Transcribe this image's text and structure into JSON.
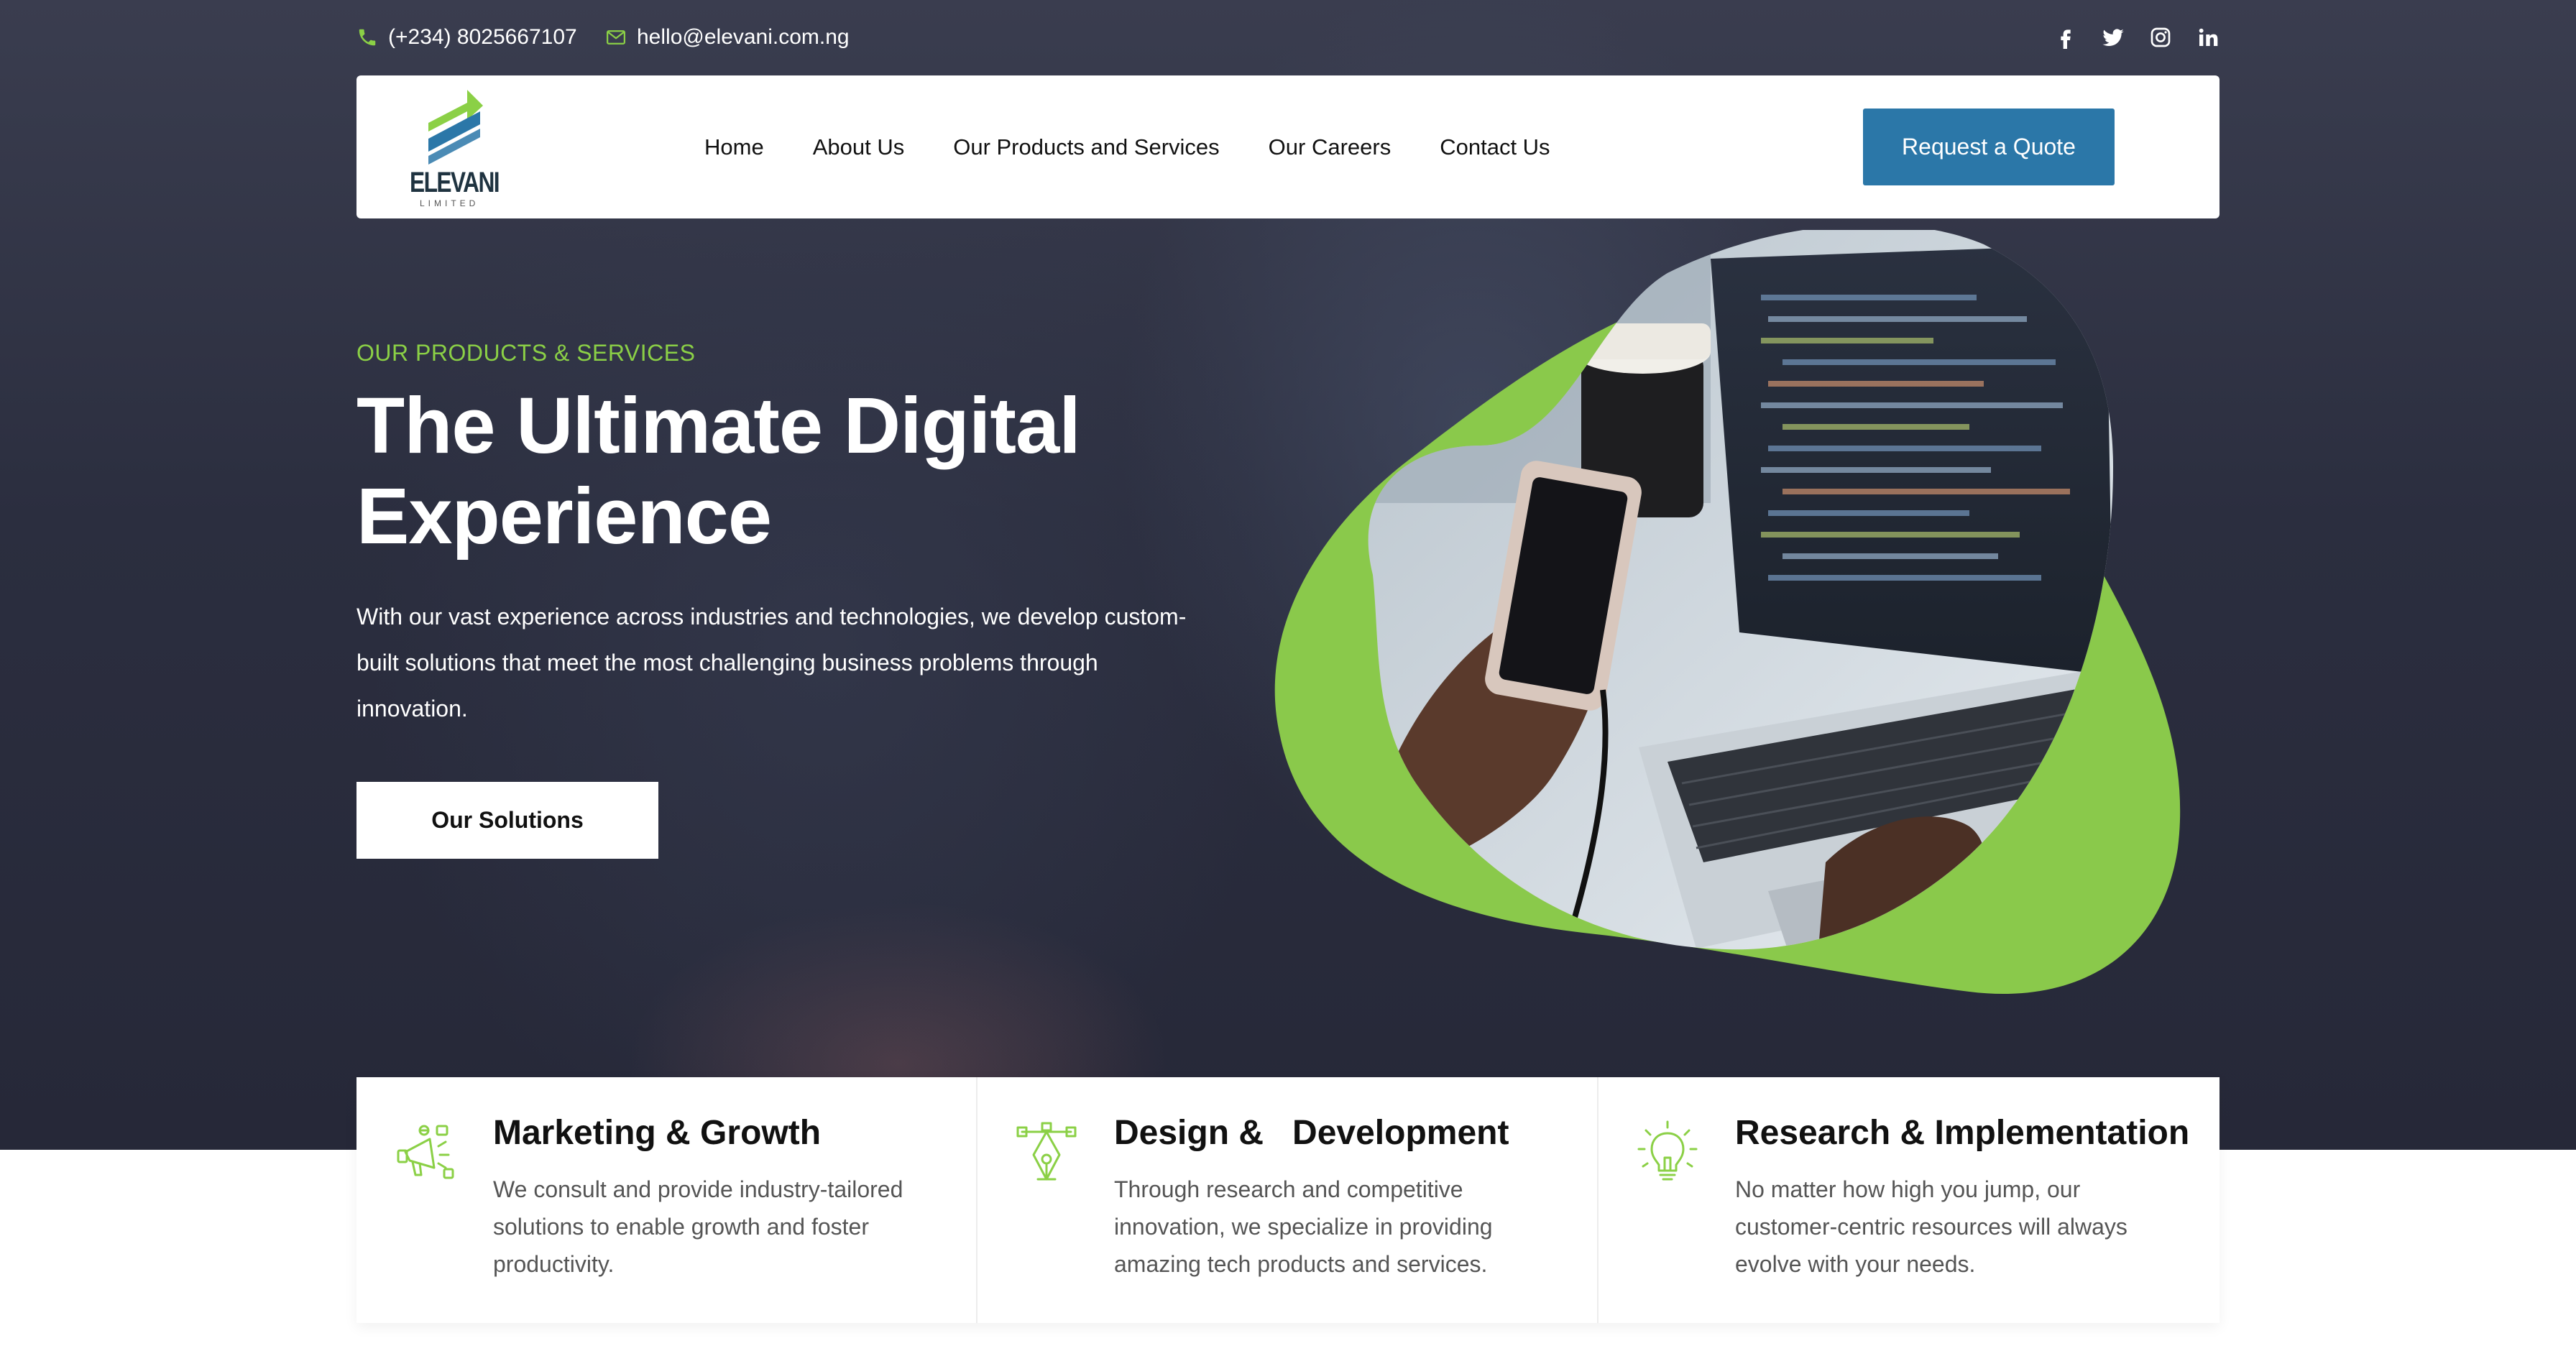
{
  "topbar": {
    "phone": "(+234) 8025667107",
    "email": "hello@elevani.com.ng",
    "socials": [
      "facebook-icon",
      "twitter-icon",
      "instagram-icon",
      "linkedin-icon"
    ]
  },
  "brand": {
    "name": "ELEVANI",
    "tagline": "LIMITED"
  },
  "nav": {
    "items": [
      {
        "label": "Home"
      },
      {
        "label": "About Us"
      },
      {
        "label": "Our Products and Services"
      },
      {
        "label": "Our Careers"
      },
      {
        "label": "Contact Us"
      }
    ],
    "cta": "Request a Quote"
  },
  "hero": {
    "eyebrow": "OUR PRODUCTS & SERVICES",
    "title_line1": "The Ultimate Digital",
    "title_line2": "Experience",
    "description": "With our vast experience across industries and technologies, we develop custom-built solutions that meet the most challenging business problems through innovation.",
    "button": "Our Solutions"
  },
  "features": [
    {
      "icon": "megaphone-icon",
      "title": "Marketing & Growth",
      "text": "We consult and provide industry-tailored solutions to enable growth and foster productivity."
    },
    {
      "icon": "pen-tool-icon",
      "title": "Design &   Development",
      "text": "Through research and competitive innovation, we specialize in providing amazing tech products and services."
    },
    {
      "icon": "lightbulb-icon",
      "title": "Research & Implementation",
      "text": "No matter how high you jump, our customer-centric resources will always evolve with your needs."
    }
  ],
  "colors": {
    "accent_green": "#8bd046",
    "cta_blue": "#2b77a8",
    "hero_bg": "#2b2e3f"
  }
}
